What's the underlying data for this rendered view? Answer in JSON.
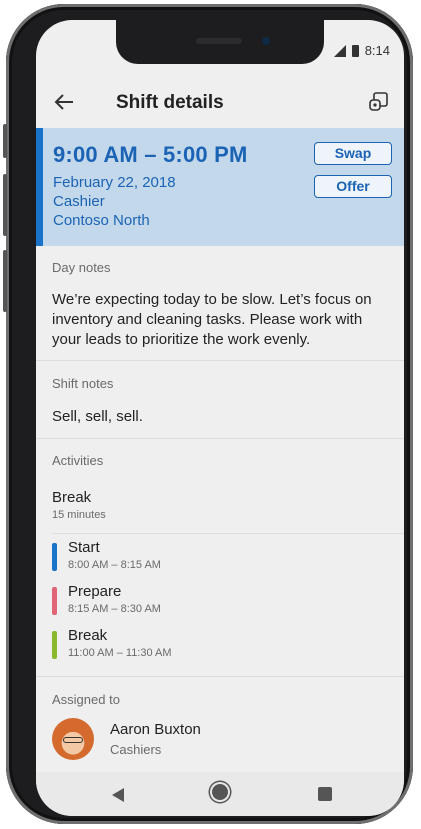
{
  "status": {
    "time": "8:14"
  },
  "appbar": {
    "title": "Shift details"
  },
  "shift": {
    "time_range": "9:00 AM – 5:00 PM",
    "date": "February 22, 2018",
    "role": "Cashier",
    "location": "Contoso North",
    "swap_label": "Swap",
    "offer_label": "Offer",
    "accent_color": "#1a73c8"
  },
  "day_notes": {
    "label": "Day notes",
    "text": "We’re expecting today to be slow. Let’s focus on inventory and cleaning tasks. Please work with your leads to prioritize the work evenly."
  },
  "shift_notes": {
    "label": "Shift notes",
    "text": "Sell, sell, sell."
  },
  "activities": {
    "label": "Activities",
    "summary": {
      "name": "Break",
      "duration": "15 minutes"
    },
    "items": [
      {
        "name": "Start",
        "time": "8:00 AM – 8:15 AM",
        "color": "#1a73c8"
      },
      {
        "name": "Prepare",
        "time": "8:15 AM – 8:30 AM",
        "color": "#e06677"
      },
      {
        "name": "Break",
        "time": "11:00 AM – 11:30 AM",
        "color": "#8ab92d"
      }
    ]
  },
  "assigned": {
    "label": "Assigned to",
    "name": "Aaron Buxton",
    "team": "Cashiers"
  }
}
